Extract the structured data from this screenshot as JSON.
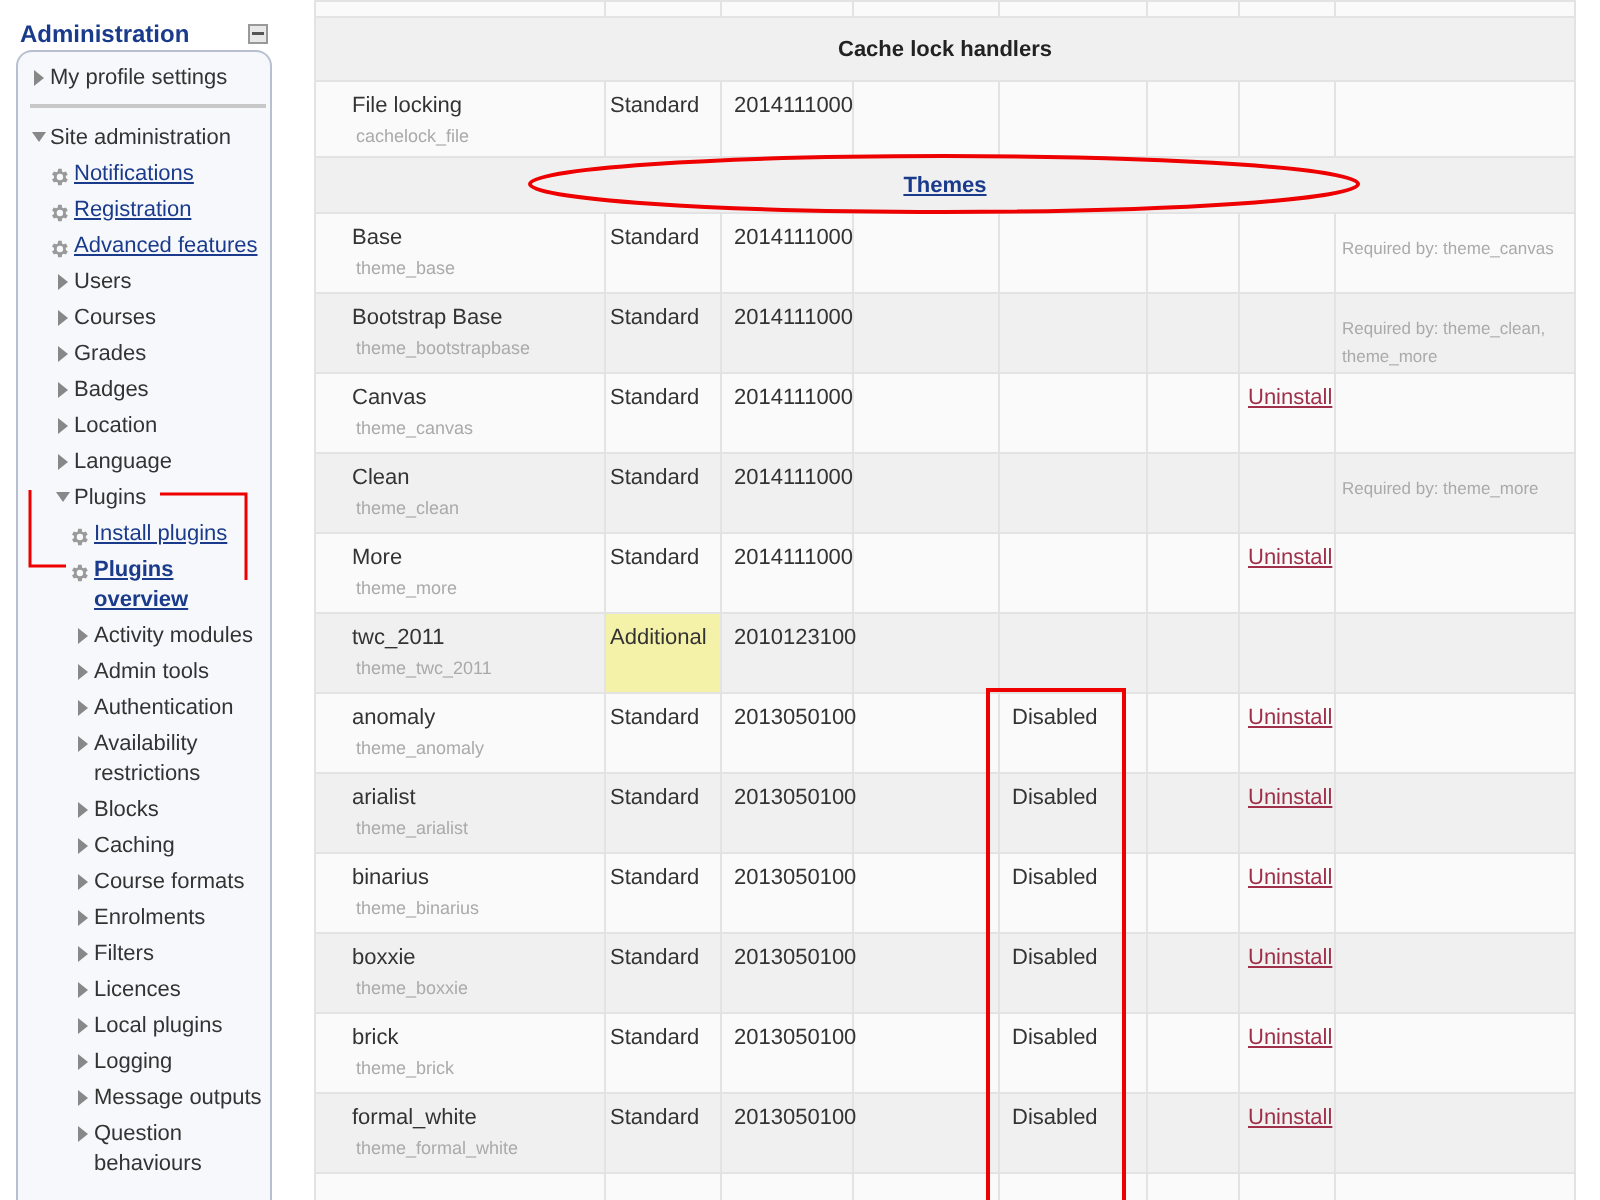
{
  "sidebar": {
    "title": "Administration",
    "items": [
      {
        "label": "My profile settings",
        "kind": "node",
        "expanded": false
      },
      {
        "label": "Site administration",
        "kind": "node",
        "expanded": true,
        "divider_before": true,
        "children": [
          {
            "label": "Notifications",
            "kind": "setting",
            "selected": false
          },
          {
            "label": "Registration",
            "kind": "setting",
            "selected": false
          },
          {
            "label": "Advanced features",
            "kind": "setting",
            "selected": false
          },
          {
            "label": "Users",
            "kind": "node",
            "expanded": false
          },
          {
            "label": "Courses",
            "kind": "node",
            "expanded": false
          },
          {
            "label": "Grades",
            "kind": "node",
            "expanded": false
          },
          {
            "label": "Badges",
            "kind": "node",
            "expanded": false
          },
          {
            "label": "Location",
            "kind": "node",
            "expanded": false
          },
          {
            "label": "Language",
            "kind": "node",
            "expanded": false
          },
          {
            "label": "Plugins",
            "kind": "node",
            "expanded": true,
            "children": [
              {
                "label": "Install plugins",
                "kind": "setting",
                "selected": false
              },
              {
                "label": "Plugins overview",
                "kind": "setting",
                "selected": true
              },
              {
                "label": "Activity modules",
                "kind": "node",
                "expanded": false
              },
              {
                "label": "Admin tools",
                "kind": "node",
                "expanded": false
              },
              {
                "label": "Authentication",
                "kind": "node",
                "expanded": false
              },
              {
                "label": "Availability restrictions",
                "kind": "node",
                "expanded": false
              },
              {
                "label": "Blocks",
                "kind": "node",
                "expanded": false
              },
              {
                "label": "Caching",
                "kind": "node",
                "expanded": false
              },
              {
                "label": "Course formats",
                "kind": "node",
                "expanded": false
              },
              {
                "label": "Enrolments",
                "kind": "node",
                "expanded": false
              },
              {
                "label": "Filters",
                "kind": "node",
                "expanded": false
              },
              {
                "label": "Licences",
                "kind": "node",
                "expanded": false
              },
              {
                "label": "Local plugins",
                "kind": "node",
                "expanded": false
              },
              {
                "label": "Logging",
                "kind": "node",
                "expanded": false
              },
              {
                "label": "Message outputs",
                "kind": "node",
                "expanded": false
              },
              {
                "label": "Question behaviours",
                "kind": "node",
                "expanded": false
              }
            ]
          }
        ]
      }
    ]
  },
  "table": {
    "sections": [
      {
        "title": "Cache lock handlers",
        "link": false,
        "rows": [
          {
            "name": "File locking",
            "component": "cachelock_file",
            "source": "Standard",
            "highlighted": false,
            "version": "2014111000"
          }
        ]
      },
      {
        "title": "Themes",
        "link": true,
        "rows": [
          {
            "name": "Base",
            "component": "theme_base",
            "source": "Standard",
            "highlighted": false,
            "version": "2014111000",
            "note": "Required by: theme_canvas"
          },
          {
            "name": "Bootstrap Base",
            "component": "theme_bootstrapbase",
            "source": "Standard",
            "highlighted": false,
            "version": "2014111000",
            "note": "Required by: theme_clean, theme_more"
          },
          {
            "name": "Canvas",
            "component": "theme_canvas",
            "source": "Standard",
            "highlighted": false,
            "version": "2014111000",
            "action": "Uninstall"
          },
          {
            "name": "Clean",
            "component": "theme_clean",
            "source": "Standard",
            "highlighted": false,
            "version": "2014111000",
            "note": "Required by: theme_more"
          },
          {
            "name": "More",
            "component": "theme_more",
            "source": "Standard",
            "highlighted": false,
            "version": "2014111000",
            "action": "Uninstall"
          },
          {
            "name": "twc_2011",
            "component": "theme_twc_2011",
            "source": "Additional",
            "highlighted": true,
            "version": "2010123100"
          },
          {
            "name": "anomaly",
            "component": "theme_anomaly",
            "source": "Standard",
            "highlighted": false,
            "version": "2013050100",
            "status": "Disabled",
            "action": "Uninstall"
          },
          {
            "name": "arialist",
            "component": "theme_arialist",
            "source": "Standard",
            "highlighted": false,
            "version": "2013050100",
            "status": "Disabled",
            "action": "Uninstall"
          },
          {
            "name": "binarius",
            "component": "theme_binarius",
            "source": "Standard",
            "highlighted": false,
            "version": "2013050100",
            "status": "Disabled",
            "action": "Uninstall"
          },
          {
            "name": "boxxie",
            "component": "theme_boxxie",
            "source": "Standard",
            "highlighted": false,
            "version": "2013050100",
            "status": "Disabled",
            "action": "Uninstall"
          },
          {
            "name": "brick",
            "component": "theme_brick",
            "source": "Standard",
            "highlighted": false,
            "version": "2013050100",
            "status": "Disabled",
            "action": "Uninstall"
          },
          {
            "name": "formal_white",
            "component": "theme_formal_white",
            "source": "Standard",
            "highlighted": false,
            "version": "2013050100",
            "status": "Disabled",
            "action": "Uninstall"
          }
        ]
      }
    ]
  }
}
